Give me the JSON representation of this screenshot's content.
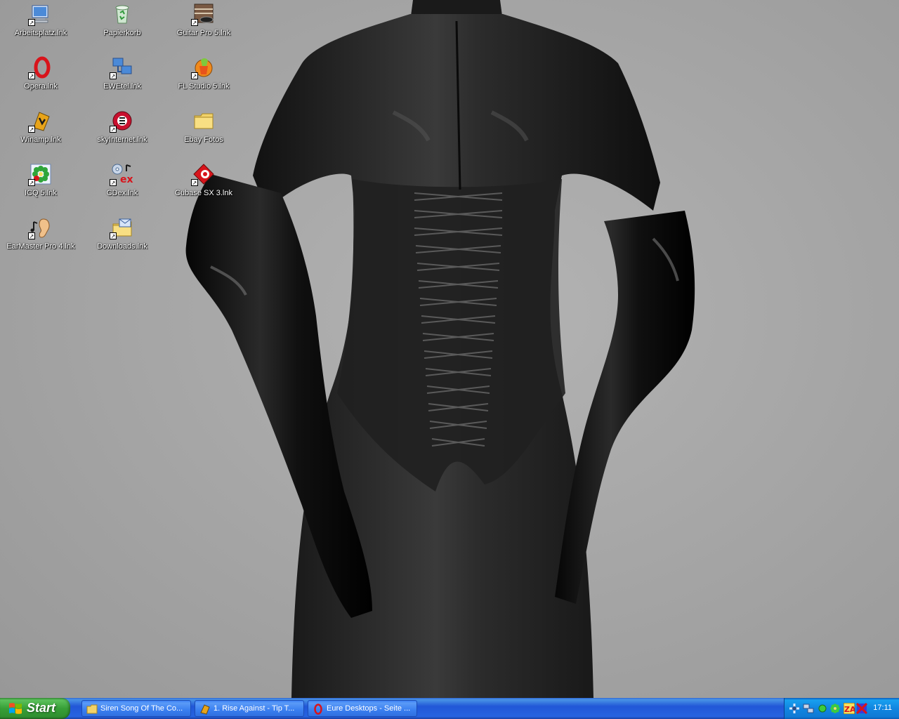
{
  "desktop": {
    "icons": [
      {
        "label": "Arbeitsplatz.lnk",
        "icon": "computer-icon"
      },
      {
        "label": "Papierkorb",
        "icon": "recycle-bin-icon"
      },
      {
        "label": "Guitar Pro 5.lnk",
        "icon": "guitar-pro-icon"
      },
      {
        "label": "Opera.lnk",
        "icon": "opera-icon"
      },
      {
        "label": "EWEtel.lnk",
        "icon": "network-icon"
      },
      {
        "label": "FL Studio 5.lnk",
        "icon": "fl-studio-icon"
      },
      {
        "label": "Winamp.lnk",
        "icon": "winamp-icon"
      },
      {
        "label": "skyInternet.lnk",
        "icon": "sky-internet-icon"
      },
      {
        "label": "Ebay Fotos",
        "icon": "folder-icon"
      },
      {
        "label": "ICQ 5.lnk",
        "icon": "icq-icon"
      },
      {
        "label": "CDex.lnk",
        "icon": "cdex-icon"
      },
      {
        "label": "Cubase SX 3.lnk",
        "icon": "cubase-icon"
      },
      {
        "label": "EarMaster Pro 4.lnk",
        "icon": "earmaster-icon"
      },
      {
        "label": "Downloads.lnk",
        "icon": "downloads-folder-icon"
      }
    ],
    "shortcut_arrow": "↗"
  },
  "taskbar": {
    "start_label": "Start",
    "tasks": [
      {
        "label": "Siren Song Of The Co...",
        "icon": "folder-icon"
      },
      {
        "label": "1. Rise Against - Tip T...",
        "icon": "winamp-icon"
      },
      {
        "label": "Eure Desktops - Seite ...",
        "icon": "opera-icon"
      }
    ],
    "tray_icons": [
      "plus-icon",
      "network-monitor-icon",
      "green-dot-icon",
      "icq-flower-icon",
      "zonealarm-icon",
      "flag-icon"
    ],
    "clock": "17:11"
  },
  "colors": {
    "taskbar_blue": "#2157d7",
    "start_green": "#379f37",
    "desktop_gray": "#a8a8a8"
  }
}
